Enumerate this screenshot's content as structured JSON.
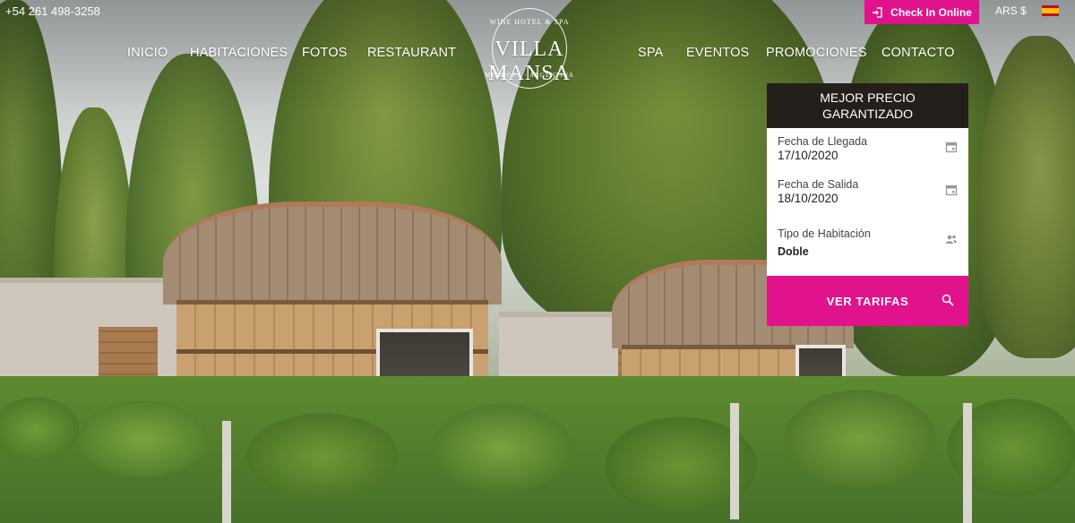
{
  "topbar": {
    "phone": "+54 261 498-3258",
    "checkin_label": "Check In Online",
    "checkin_icon": "sign-in-icon",
    "currency": "ARS $",
    "language_flag": "spain-flag-icon"
  },
  "nav": {
    "left": [
      "INICIO",
      "HABITACIONES",
      "FOTOS",
      "RESTAURANT"
    ],
    "right": [
      "SPA",
      "EVENTOS",
      "PROMOCIONES",
      "CONTACTO"
    ]
  },
  "logo": {
    "tagline": "WINE HOTEL & SPA",
    "name": "VILLA MANSA",
    "sub": "MENDOZA · ARGENTINA"
  },
  "booking": {
    "title_line1": "MEJOR PRECIO",
    "title_line2": "GARANTIZADO",
    "arrival_label": "Fecha de Llegada",
    "arrival_value": "17/10/2020",
    "departure_label": "Fecha de Salida",
    "departure_value": "18/10/2020",
    "room_label": "Tipo de Habitación",
    "room_value": "Doble",
    "submit_label": "VER TARIFAS"
  },
  "colors": {
    "accent": "#e0138c",
    "header_dark": "#241f1a"
  }
}
